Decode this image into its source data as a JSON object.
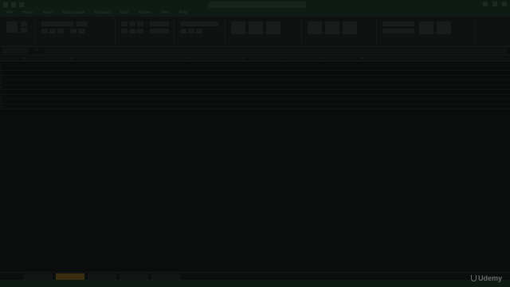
{
  "window": {
    "title": ""
  },
  "menu": [
    "File",
    "Home",
    "Insert",
    "Page Layout",
    "Formulas",
    "Data",
    "Review",
    "View",
    "Help"
  ],
  "formula_bar": {
    "name_box": "",
    "fx_label": "fx",
    "value": ""
  },
  "columns": [
    "A",
    "B",
    "C",
    "D",
    "E",
    "F",
    "G",
    "H",
    "I",
    "J",
    "K",
    "L",
    "M"
  ],
  "rows": [
    {
      "n": "1",
      "a": "",
      "b": "",
      "c": "",
      "d": "",
      "e": "",
      "f": "",
      "g": "",
      "h": "",
      "i": ""
    },
    {
      "n": "2",
      "a": "",
      "b": "",
      "c": "",
      "d": "",
      "e": "",
      "f": "",
      "g": "",
      "h": "",
      "i": ""
    },
    {
      "n": "3",
      "a": "",
      "b": "",
      "c": "",
      "d": "",
      "e": "",
      "f": "",
      "g": "",
      "h": "",
      "i": ""
    },
    {
      "n": "4",
      "a": "",
      "b": "",
      "c": "",
      "d": "",
      "e": "",
      "f": "",
      "g": "",
      "h": "",
      "i": ""
    },
    {
      "n": "5",
      "a": "",
      "b": "",
      "c": "",
      "d": "",
      "e": "",
      "f": "",
      "g": "",
      "h": "",
      "i": ""
    },
    {
      "n": "6",
      "a": "",
      "b": "",
      "c": "",
      "d": "",
      "e": "",
      "f": "",
      "g": "",
      "h": "",
      "i": ""
    },
    {
      "n": "7",
      "a": "",
      "b": "",
      "c": "",
      "d": "",
      "e": "",
      "f": "",
      "g": "",
      "h": "",
      "i": ""
    },
    {
      "n": "8",
      "a": "",
      "b": "",
      "c": "",
      "d": "",
      "e": "",
      "f": "",
      "g": "",
      "h": "",
      "i": ""
    },
    {
      "n": "9",
      "a": "",
      "b": "",
      "c": "",
      "d": "",
      "e": "",
      "f": "",
      "g": "",
      "h": "",
      "i": ""
    },
    {
      "n": "10",
      "a": "",
      "b": "",
      "c": "",
      "d": "",
      "e": "",
      "f": "",
      "g": "",
      "h": "",
      "i": ""
    }
  ],
  "sheet_tabs": [
    {
      "label": "",
      "active": false
    },
    {
      "label": "",
      "active": true
    },
    {
      "label": "",
      "active": false
    },
    {
      "label": "",
      "active": false
    },
    {
      "label": "",
      "active": false
    }
  ],
  "status": {
    "text": ""
  },
  "watermark": {
    "text": "Udemy"
  },
  "colors": {
    "accent_tab": "#3a2e0f",
    "titlebar": "#0f1a14",
    "background": "#0b0c0c"
  }
}
